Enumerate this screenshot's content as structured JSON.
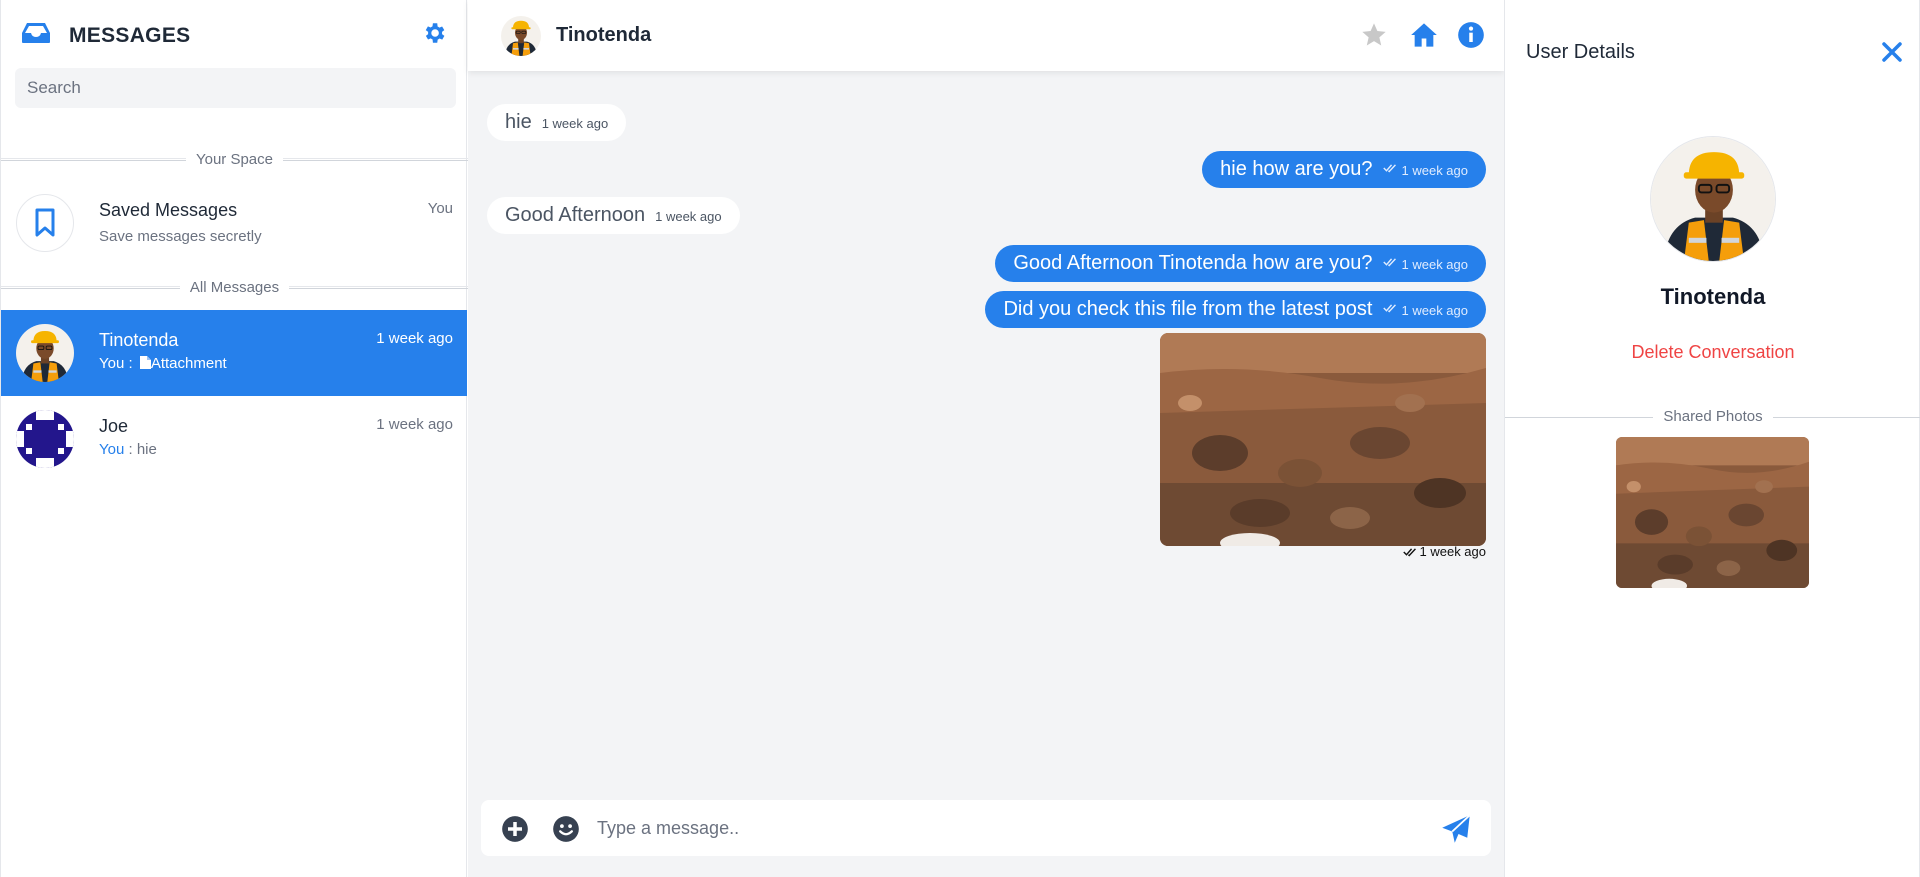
{
  "sidebar": {
    "title": "MESSAGES",
    "search_placeholder": "Search",
    "section_your_space": "Your Space",
    "section_all_messages": "All Messages",
    "saved": {
      "name": "Saved Messages",
      "subtitle": "Save messages secretly",
      "meta": "You"
    },
    "conversations": [
      {
        "name": "Tinotenda",
        "time": "1 week ago",
        "prefix": "You :",
        "preview": "Attachment",
        "active": true
      },
      {
        "name": "Joe",
        "time": "1 week ago",
        "prefix": "You",
        "preview": ": hie",
        "active": false
      }
    ]
  },
  "chat": {
    "contact_name": "Tinotenda",
    "messages": [
      {
        "direction": "in",
        "text": "hie",
        "time": "1 week ago"
      },
      {
        "direction": "out",
        "text": "hie how are you?",
        "time": "1 week ago"
      },
      {
        "direction": "in",
        "text": "Good Afternoon",
        "time": "1 week ago"
      },
      {
        "direction": "out",
        "text": "Good Afternoon Tinotenda how are you?",
        "time": "1 week ago"
      },
      {
        "direction": "out",
        "text": "Did you check this file from the latest post",
        "time": "1 week ago"
      }
    ],
    "attachment_time": "1 week ago",
    "composer_placeholder": "Type a message.."
  },
  "details": {
    "title": "User Details",
    "name": "Tinotenda",
    "delete_label": "Delete Conversation",
    "shared_photos_label": "Shared Photos"
  },
  "colors": {
    "accent": "#2680eb",
    "danger": "#ef4444",
    "chat_bg": "#f3f4f6"
  },
  "icons": [
    "inbox-icon",
    "gear-icon",
    "bookmark-icon",
    "star-icon",
    "home-icon",
    "info-icon",
    "close-icon",
    "plus-circle-icon",
    "emoji-icon",
    "send-icon",
    "double-check-icon",
    "file-icon"
  ]
}
